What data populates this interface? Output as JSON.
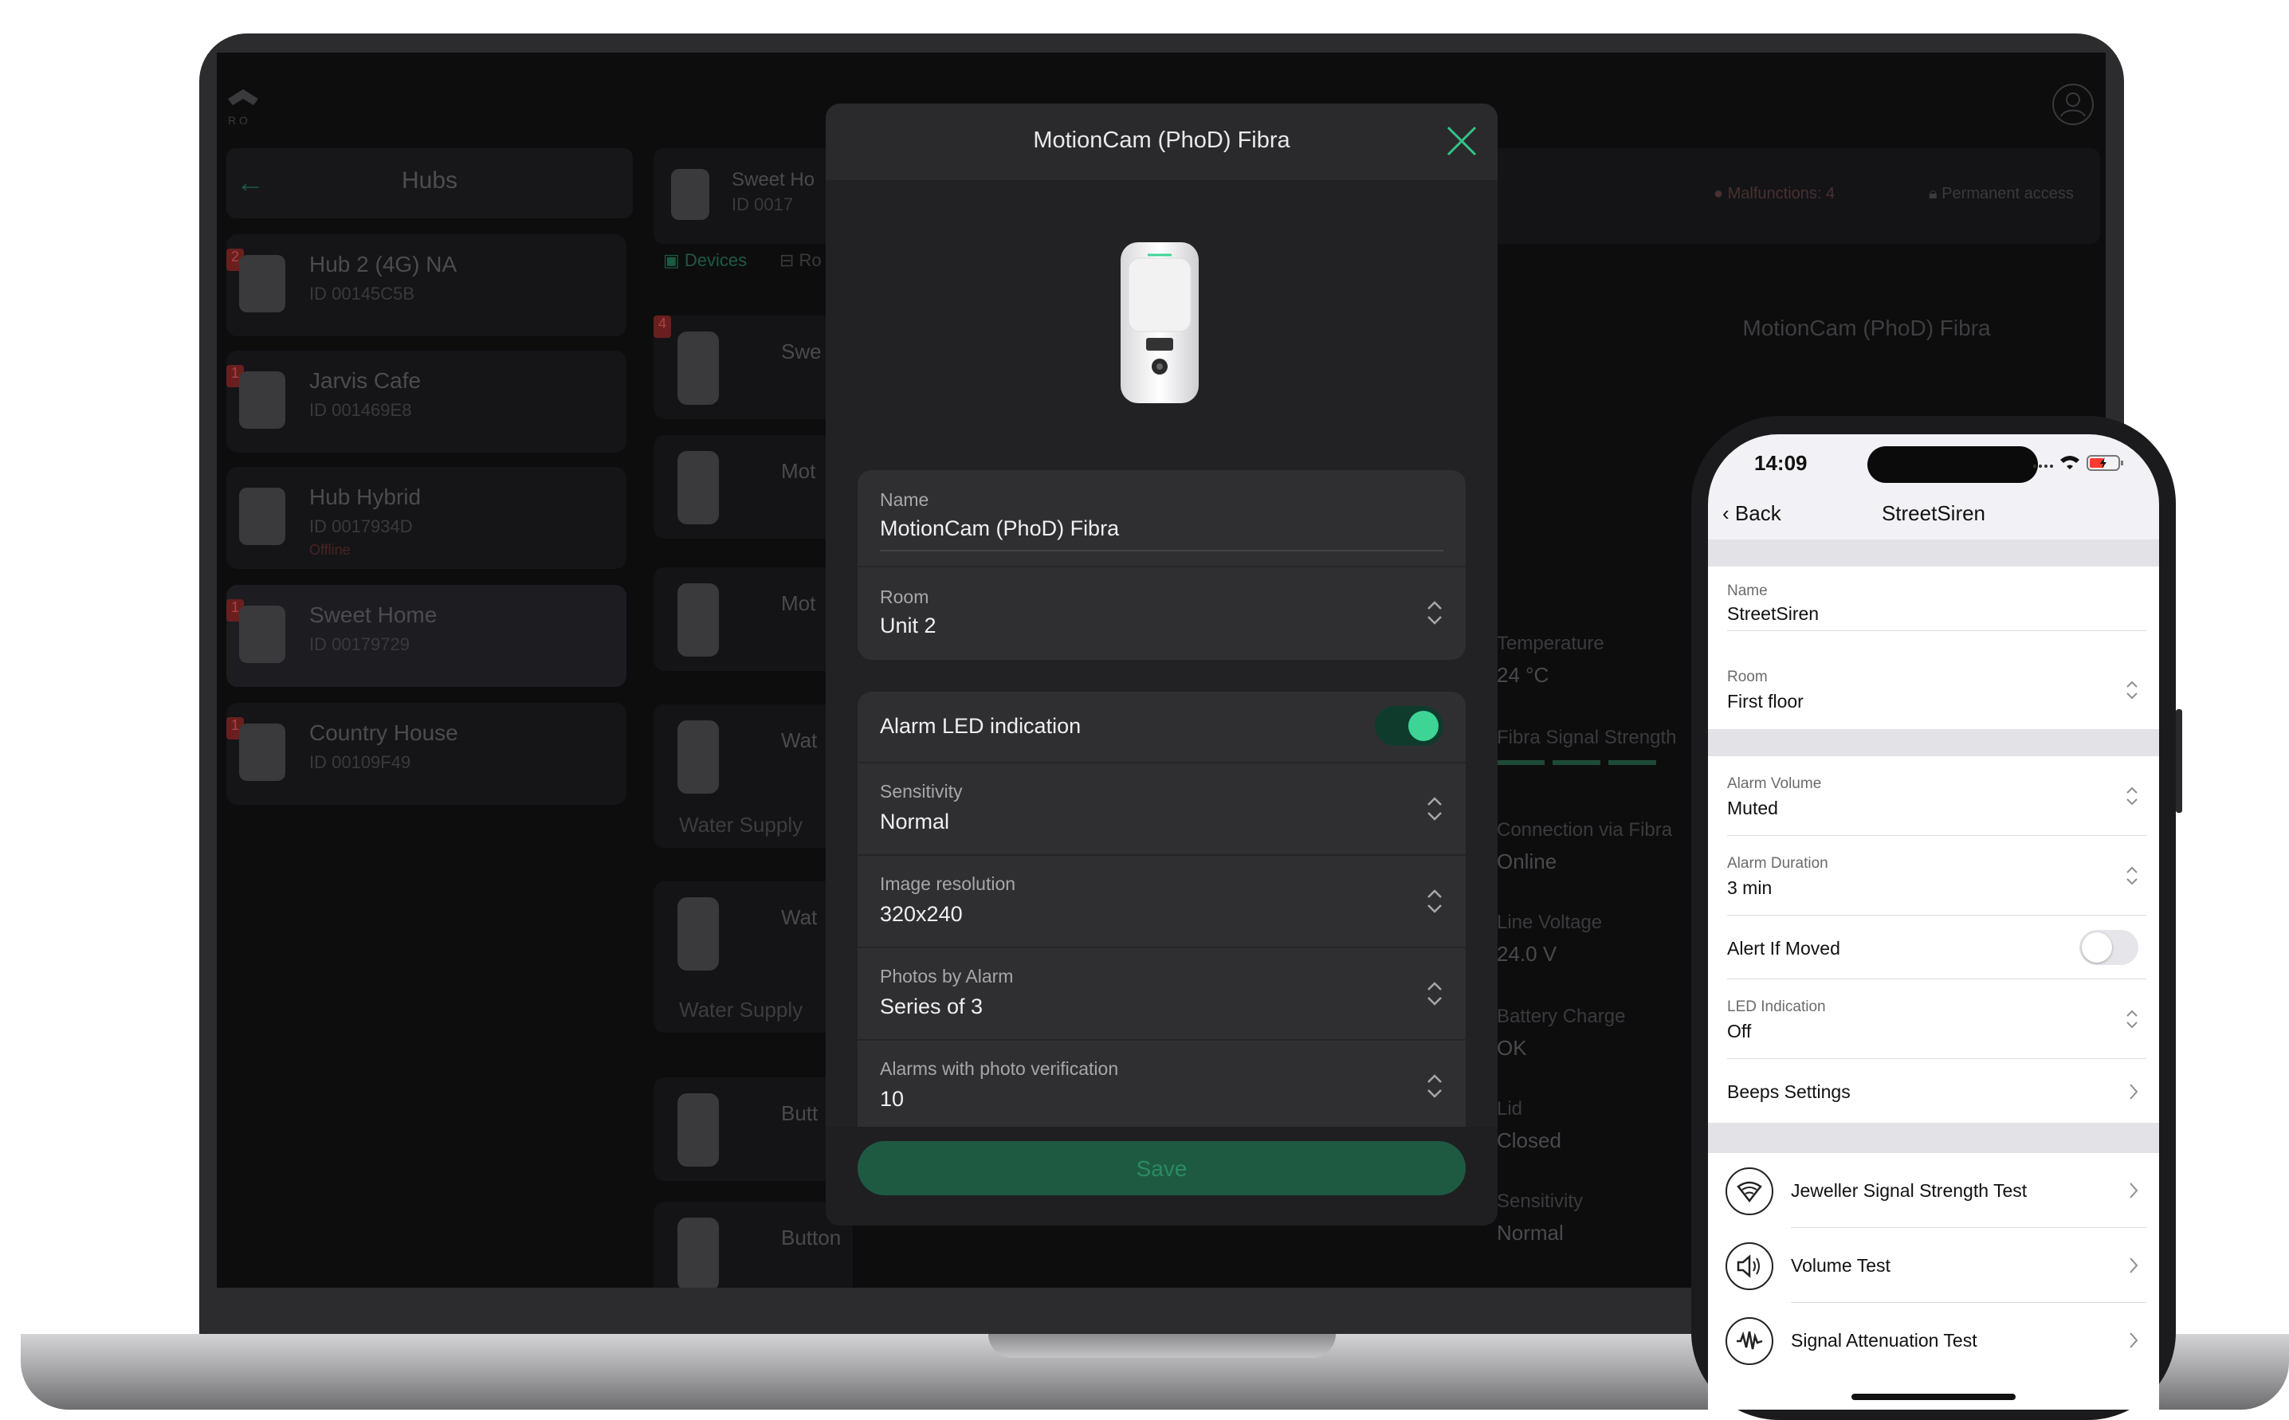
{
  "desktop_app": {
    "hubs_header": "Hubs",
    "hubs": [
      {
        "name": "Hub 2 (4G) NA",
        "id": "ID 00145C5B",
        "status": "",
        "badge": "2"
      },
      {
        "name": "Jarvis Cafe",
        "id": "ID 001469E8",
        "status": "",
        "badge": "1"
      },
      {
        "name": "Hub Hybrid",
        "id": "ID 0017934D",
        "status": "Offline",
        "badge": ""
      },
      {
        "name": "Sweet Home",
        "id": "ID 00179729",
        "status": "",
        "badge": "1"
      },
      {
        "name": "Country House",
        "id": "ID 00109F49",
        "status": "",
        "badge": "1"
      }
    ],
    "top_bar": {
      "hub_name": "Sweet Ho",
      "hub_id": "ID 0017",
      "malfunctions": "Malfunctions: 4",
      "permanent_access": "Permanent access"
    },
    "tabs": {
      "devices": "Devices",
      "rooms": "Ro"
    },
    "device_list": [
      {
        "name": "Swe",
        "badge": "4"
      },
      {
        "name": "Mot"
      },
      {
        "name": "Mot"
      },
      {
        "name": "Wat",
        "footer": "Water Supply"
      },
      {
        "name": "Wat",
        "footer": "Water Supply"
      },
      {
        "name": "Butt"
      },
      {
        "name": "Button"
      }
    ],
    "detail_panel": {
      "title": "MotionCam (PhoD) Fibra",
      "fields": [
        {
          "label": "Temperature",
          "value": "24 °C"
        },
        {
          "label": "Fibra Signal Strength",
          "value": ""
        },
        {
          "label": "Connection via Fibra",
          "value": "Online"
        },
        {
          "label": "Line Voltage",
          "value": "24.0 V"
        },
        {
          "label": "Battery Charge",
          "value": "OK"
        },
        {
          "label": "Lid",
          "value": "Closed"
        },
        {
          "label": "Sensitivity",
          "value": "Normal"
        }
      ]
    }
  },
  "modal": {
    "title": "MotionCam (PhoD) Fibra",
    "name_field": {
      "label": "Name",
      "value": "MotionCam (PhoD) Fibra"
    },
    "room_field": {
      "label": "Room",
      "value": "Unit 2"
    },
    "alarm_led": {
      "label": "Alarm LED indication",
      "enabled": true
    },
    "sensitivity": {
      "label": "Sensitivity",
      "value": "Normal"
    },
    "image_resolution": {
      "label": "Image resolution",
      "value": "320x240"
    },
    "photos_by_alarm": {
      "label": "Photos by Alarm",
      "value": "Series of 3"
    },
    "alarms_photo_verification": {
      "label": "Alarms with photo verification",
      "value": "10"
    },
    "save_label": "Save",
    "accent_color": "#3dd496"
  },
  "phone": {
    "status_time": "14:09",
    "back_label": "Back",
    "title": "StreetSiren",
    "name": {
      "label": "Name",
      "value": "StreetSiren"
    },
    "room": {
      "label": "Room",
      "value": "First floor"
    },
    "alarm_volume": {
      "label": "Alarm Volume",
      "value": "Muted"
    },
    "alarm_duration": {
      "label": "Alarm Duration",
      "value": "3 min"
    },
    "alert_if_moved": {
      "label": "Alert If Moved",
      "enabled": false
    },
    "led_indication": {
      "label": "LED Indication",
      "value": "Off"
    },
    "beeps_settings": "Beeps Settings",
    "tests": [
      {
        "label": "Jeweller Signal Strength Test",
        "icon": "signal-strength-icon"
      },
      {
        "label": "Volume Test",
        "icon": "speaker-icon"
      },
      {
        "label": "Signal Attenuation Test",
        "icon": "waveform-icon"
      }
    ]
  }
}
